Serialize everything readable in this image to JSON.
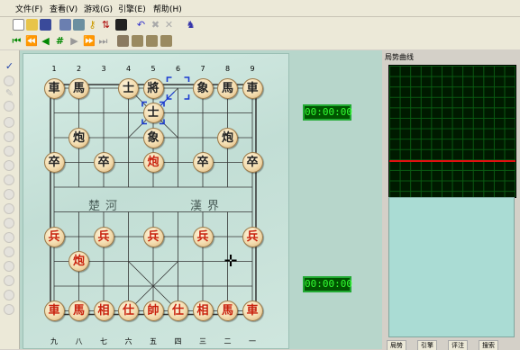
{
  "menu": {
    "file": "文件(F)",
    "view": "查看(V)",
    "game": "游戏(G)",
    "engine": "引擎(E)",
    "help": "帮助(H)"
  },
  "toolbar1_icons": [
    "new-file-icon",
    "open-folder-icon",
    "save-icon",
    "board-edit-icon",
    "board-view-icon",
    "key-icon",
    "flip-icon",
    "console-icon",
    "swap-icon",
    "undo-icon",
    "cancel-icon",
    "stop-icon",
    "find-icon"
  ],
  "toolbar2_icons": [
    "first-move-icon",
    "back-fast-icon",
    "back-icon",
    "hash-icon",
    "forward-icon",
    "forward-fast-icon",
    "last-move-icon",
    "print-icon",
    "copy-icon",
    "copy2-icon",
    "copy3-icon"
  ],
  "left_toolbar_icons": [
    "check-icon",
    "circle-icon",
    "pencil-icon",
    "arrow-icon",
    "piece-icon",
    "piece-icon",
    "piece-icon",
    "piece-icon",
    "piece-icon",
    "piece-icon",
    "piece-icon",
    "piece-icon",
    "piece-icon",
    "piece-icon",
    "piece-icon",
    "piece-icon",
    "piece-icon",
    "piece-icon",
    "piece-icon",
    "piece-icon",
    "piece-icon",
    "piece-icon"
  ],
  "board": {
    "top_files": [
      "1",
      "2",
      "3",
      "4",
      "5",
      "6",
      "7",
      "8",
      "9"
    ],
    "bottom_files": [
      "九",
      "八",
      "七",
      "六",
      "五",
      "四",
      "三",
      "二",
      "一"
    ],
    "river_left": "楚河",
    "river_right": "漢界",
    "pieces": [
      {
        "t": "車",
        "s": "black",
        "c": 0,
        "r": 0
      },
      {
        "t": "馬",
        "s": "black",
        "c": 1,
        "r": 0
      },
      {
        "t": "士",
        "s": "black",
        "c": 3,
        "r": 0
      },
      {
        "t": "將",
        "s": "black",
        "c": 4,
        "r": 0
      },
      {
        "t": "象",
        "s": "black",
        "c": 6,
        "r": 0
      },
      {
        "t": "馬",
        "s": "black",
        "c": 7,
        "r": 0
      },
      {
        "t": "車",
        "s": "black",
        "c": 8,
        "r": 0
      },
      {
        "t": "士",
        "s": "black",
        "c": 4,
        "r": 1
      },
      {
        "t": "炮",
        "s": "black",
        "c": 1,
        "r": 2
      },
      {
        "t": "象",
        "s": "black",
        "c": 4,
        "r": 2
      },
      {
        "t": "炮",
        "s": "black",
        "c": 7,
        "r": 2
      },
      {
        "t": "卒",
        "s": "black",
        "c": 0,
        "r": 3
      },
      {
        "t": "卒",
        "s": "black",
        "c": 2,
        "r": 3
      },
      {
        "t": "炮",
        "s": "red",
        "c": 4,
        "r": 3
      },
      {
        "t": "卒",
        "s": "black",
        "c": 6,
        "r": 3
      },
      {
        "t": "卒",
        "s": "black",
        "c": 8,
        "r": 3
      },
      {
        "t": "兵",
        "s": "red",
        "c": 0,
        "r": 6
      },
      {
        "t": "兵",
        "s": "red",
        "c": 2,
        "r": 6
      },
      {
        "t": "兵",
        "s": "red",
        "c": 4,
        "r": 6
      },
      {
        "t": "兵",
        "s": "red",
        "c": 6,
        "r": 6
      },
      {
        "t": "兵",
        "s": "red",
        "c": 8,
        "r": 6
      },
      {
        "t": "炮",
        "s": "red",
        "c": 1,
        "r": 7
      },
      {
        "t": "車",
        "s": "red",
        "c": 0,
        "r": 9
      },
      {
        "t": "馬",
        "s": "red",
        "c": 1,
        "r": 9
      },
      {
        "t": "相",
        "s": "red",
        "c": 2,
        "r": 9
      },
      {
        "t": "仕",
        "s": "red",
        "c": 3,
        "r": 9
      },
      {
        "t": "帥",
        "s": "red",
        "c": 4,
        "r": 9
      },
      {
        "t": "仕",
        "s": "red",
        "c": 5,
        "r": 9
      },
      {
        "t": "相",
        "s": "red",
        "c": 6,
        "r": 9
      },
      {
        "t": "馬",
        "s": "red",
        "c": 7,
        "r": 9
      },
      {
        "t": "車",
        "s": "red",
        "c": 8,
        "r": 9
      }
    ],
    "last_move_from": {
      "c": 5,
      "r": 0
    },
    "last_move_to": {
      "c": 4,
      "r": 1
    }
  },
  "clocks": {
    "top": "00:00:00",
    "bottom": "00:00:00"
  },
  "panel": {
    "title": "局势曲线",
    "tabs": [
      "局势",
      "引擎",
      "评注",
      "搜索"
    ]
  },
  "colors": {
    "red_piece": "#c8200c",
    "black_piece": "#222222",
    "clock_digits": "#33ff33",
    "trend_line": "#e01010"
  }
}
